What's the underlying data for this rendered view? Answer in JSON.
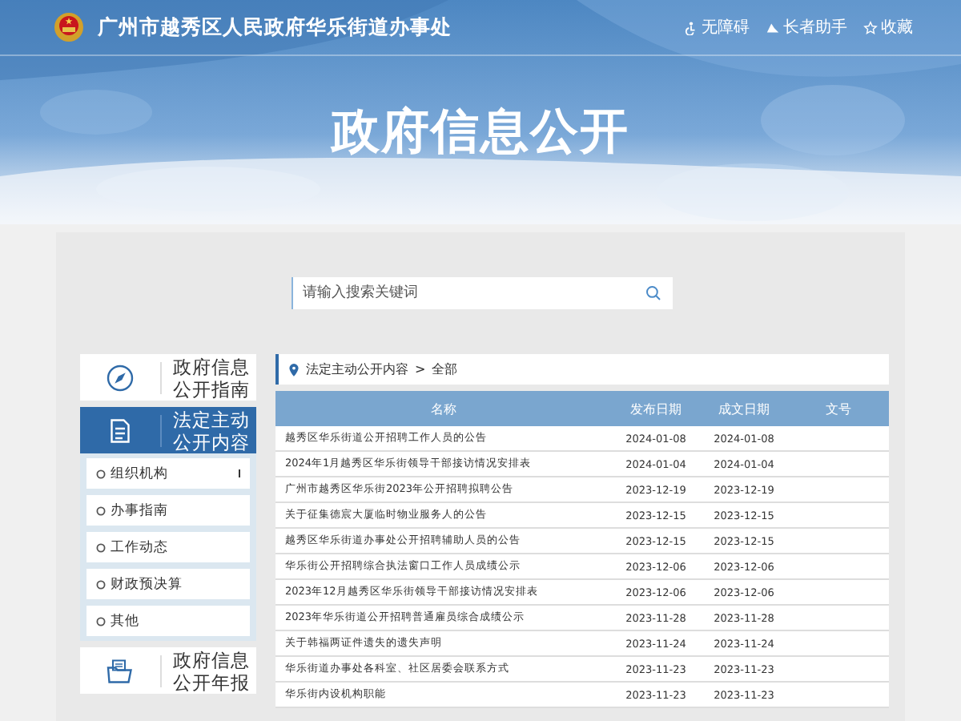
{
  "header": {
    "site_title": "广州市越秀区人民政府华乐街道办事处",
    "links": [
      {
        "label": "无障碍"
      },
      {
        "label": "长者助手"
      },
      {
        "label": "收藏"
      }
    ],
    "banner_title": "政府信息公开"
  },
  "search": {
    "placeholder": "请输入搜索关键词"
  },
  "sidebar": [
    {
      "label": "政府信息公开指南",
      "selected": false
    },
    {
      "label": "法定主动公开内容",
      "selected": true,
      "children": [
        {
          "label": "组织机构",
          "has_children": true
        },
        {
          "label": "办事指南",
          "has_children": false
        },
        {
          "label": "工作动态",
          "has_children": false
        },
        {
          "label": "财政预决算",
          "has_children": false
        },
        {
          "label": "其他",
          "has_children": false
        }
      ]
    },
    {
      "label": "政府信息公开年报",
      "selected": false
    }
  ],
  "breadcrumb": {
    "path": [
      "法定主动公开内容",
      "全部"
    ],
    "separator": ">"
  },
  "table": {
    "columns": [
      "名称",
      "发布日期",
      "成文日期",
      "文号"
    ],
    "rows": [
      [
        "越秀区华乐街道公开招聘工作人员的公告",
        "2024-01-08",
        "2024-01-08"
      ],
      [
        "2024年1月越秀区华乐街领导干部接访情况安排表",
        "2024-01-04",
        "2024-01-04"
      ],
      [
        "广州市越秀区华乐街2023年公开招聘拟聘公告",
        "2023-12-19",
        "2023-12-19"
      ],
      [
        "关于征集德宸大厦临时物业服务人的公告",
        "2023-12-15",
        "2023-12-15"
      ],
      [
        "越秀区华乐街道办事处公开招聘辅助人员的公告",
        "2023-12-15",
        "2023-12-15"
      ],
      [
        "华乐街公开招聘综合执法窗口工作人员成绩公示",
        "2023-12-06",
        "2023-12-06"
      ],
      [
        "2023年12月越秀区华乐街领导干部接访情况安排表",
        "2023-12-06",
        "2023-12-06"
      ],
      [
        "2023年华乐街道公开招聘普通雇员综合成绩公示",
        "2023-11-28",
        "2023-11-28"
      ],
      [
        "关于韩福两证件遗失的遗失声明",
        "2023-11-24",
        "2023-11-24"
      ],
      [
        "华乐街道办事处各科室、社区居委会联系方式",
        "2023-11-23",
        "2023-11-23"
      ],
      [
        "华乐街内设机构职能",
        "2023-11-23",
        "2023-11-23"
      ]
    ]
  }
}
